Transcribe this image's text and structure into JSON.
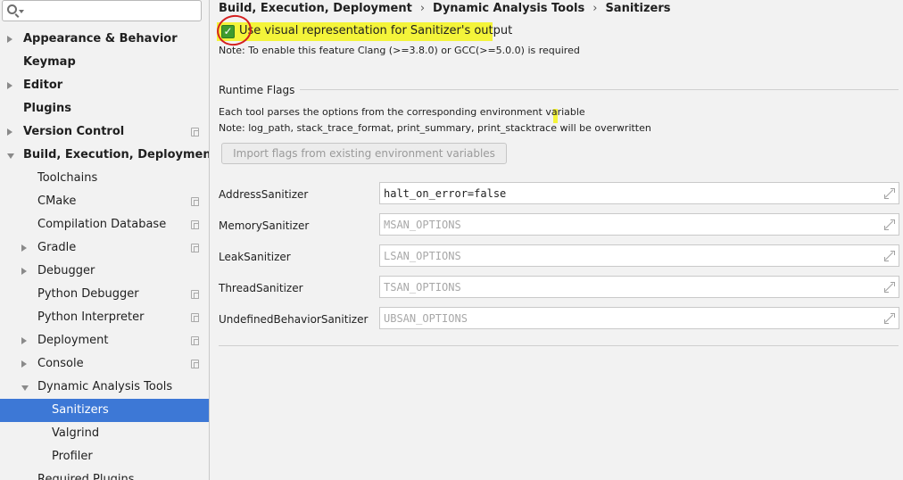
{
  "search": {
    "placeholder": "",
    "value": ""
  },
  "sidebar": {
    "items": [
      {
        "label": "Appearance & Behavior",
        "bold": true,
        "arrow": "right",
        "level": 0,
        "proj": false
      },
      {
        "label": "Keymap",
        "bold": true,
        "arrow": "none",
        "level": 0,
        "proj": false
      },
      {
        "label": "Editor",
        "bold": true,
        "arrow": "right",
        "level": 0,
        "proj": false
      },
      {
        "label": "Plugins",
        "bold": true,
        "arrow": "none",
        "level": 0,
        "proj": false
      },
      {
        "label": "Version Control",
        "bold": true,
        "arrow": "right",
        "level": 0,
        "proj": true
      },
      {
        "label": "Build, Execution, Deployment",
        "bold": true,
        "arrow": "down",
        "level": 0,
        "proj": false
      },
      {
        "label": "Toolchains",
        "bold": false,
        "arrow": "none",
        "level": 1,
        "proj": false
      },
      {
        "label": "CMake",
        "bold": false,
        "arrow": "none",
        "level": 1,
        "proj": true
      },
      {
        "label": "Compilation Database",
        "bold": false,
        "arrow": "none",
        "level": 1,
        "proj": true
      },
      {
        "label": "Gradle",
        "bold": false,
        "arrow": "right",
        "level": 1,
        "proj": true
      },
      {
        "label": "Debugger",
        "bold": false,
        "arrow": "right",
        "level": 1,
        "proj": false
      },
      {
        "label": "Python Debugger",
        "bold": false,
        "arrow": "none",
        "level": 1,
        "proj": true
      },
      {
        "label": "Python Interpreter",
        "bold": false,
        "arrow": "none",
        "level": 1,
        "proj": true
      },
      {
        "label": "Deployment",
        "bold": false,
        "arrow": "right",
        "level": 1,
        "proj": true
      },
      {
        "label": "Console",
        "bold": false,
        "arrow": "right",
        "level": 1,
        "proj": true
      },
      {
        "label": "Dynamic Analysis Tools",
        "bold": false,
        "arrow": "down",
        "level": 1,
        "proj": false
      },
      {
        "label": "Sanitizers",
        "bold": false,
        "arrow": "none",
        "level": 2,
        "proj": false,
        "selected": true
      },
      {
        "label": "Valgrind",
        "bold": false,
        "arrow": "none",
        "level": 2,
        "proj": false
      },
      {
        "label": "Profiler",
        "bold": false,
        "arrow": "none",
        "level": 2,
        "proj": false
      },
      {
        "label": "Required Plugins",
        "bold": false,
        "arrow": "none",
        "level": 1,
        "proj": false
      }
    ]
  },
  "breadcrumb": [
    "Build, Execution, Deployment",
    "Dynamic Analysis Tools",
    "Sanitizers"
  ],
  "breadcrumb_sep": "›",
  "visual_checkbox": {
    "label": "Use visual representation for Sanitizer's output",
    "checked": true,
    "mark": "✓"
  },
  "note_clang": "Note: To enable this feature Clang (>=3.8.0) or GCC(>=5.0.0) is required",
  "runtime_flags": {
    "title": "Runtime Flags",
    "desc": "Each tool parses the options from the corresponding environment variable",
    "note": "Note: log_path, stack_trace_format, print_summary, print_stacktrace will be overwritten",
    "import_button": "Import flags from existing environment variables"
  },
  "sanitizers": [
    {
      "label": "AddressSanitizer",
      "value": "halt_on_error=false",
      "placeholder": ""
    },
    {
      "label": "MemorySanitizer",
      "value": "",
      "placeholder": "MSAN_OPTIONS"
    },
    {
      "label": "LeakSanitizer",
      "value": "",
      "placeholder": "LSAN_OPTIONS"
    },
    {
      "label": "ThreadSanitizer",
      "value": "",
      "placeholder": "TSAN_OPTIONS"
    },
    {
      "label": "UndefinedBehaviorSanitizer",
      "value": "",
      "placeholder": "UBSAN_OPTIONS"
    }
  ],
  "colors": {
    "selection": "#3d78d6",
    "highlight": "#f4f43a",
    "annotation_circle": "#d42020",
    "checkbox": "#3f9b2e"
  }
}
